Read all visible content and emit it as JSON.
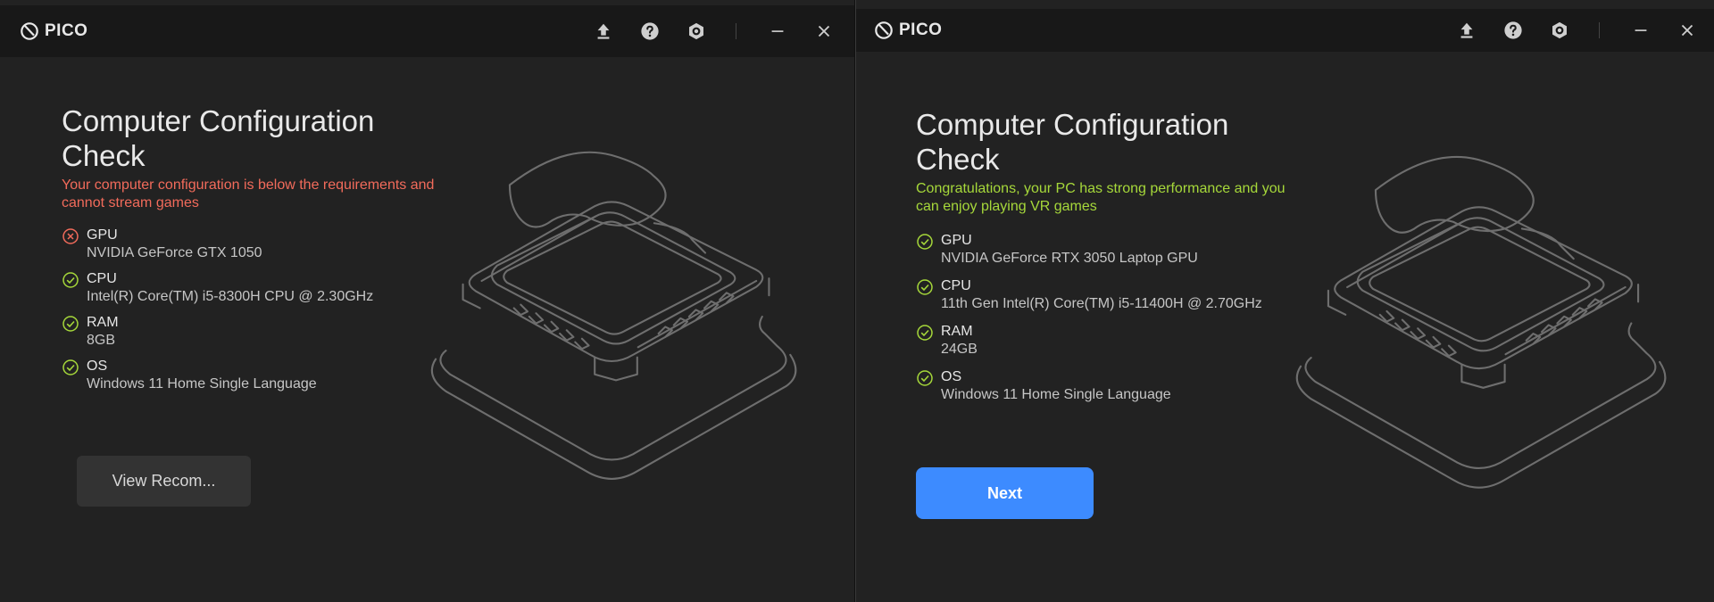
{
  "left": {
    "brand": "PICO",
    "title": "Computer Configuration Check",
    "status": "Your computer configuration is below the requirements and cannot stream games",
    "items": [
      {
        "name": "GPU",
        "value": "NVIDIA GeForce GTX 1050",
        "state": "fail"
      },
      {
        "name": "CPU",
        "value": "Intel(R) Core(TM) i5-8300H CPU @ 2.30GHz",
        "state": "pass"
      },
      {
        "name": "RAM",
        "value": "8GB",
        "state": "pass"
      },
      {
        "name": "OS",
        "value": "Windows 11 Home Single Language",
        "state": "pass"
      }
    ],
    "button": "View Recom..."
  },
  "right": {
    "brand": "PICO",
    "title": "Computer Configuration Check",
    "status": "Congratulations, your PC has strong performance and you can enjoy playing VR games",
    "items": [
      {
        "name": "GPU",
        "value": "NVIDIA GeForce RTX 3050 Laptop GPU",
        "state": "pass"
      },
      {
        "name": "CPU",
        "value": "11th Gen Intel(R) Core(TM) i5-11400H @ 2.70GHz",
        "state": "pass"
      },
      {
        "name": "RAM",
        "value": "24GB",
        "state": "pass"
      },
      {
        "name": "OS",
        "value": "Windows 11 Home Single Language",
        "state": "pass"
      }
    ],
    "button": "Next"
  },
  "colors": {
    "fail": "#f26b5b",
    "pass": "#a6d83a",
    "primary": "#3d8bff"
  },
  "icons": [
    "upload-icon",
    "help-icon",
    "settings-icon",
    "minimize-icon",
    "close-icon",
    "fail-circle-icon",
    "check-circle-icon"
  ]
}
